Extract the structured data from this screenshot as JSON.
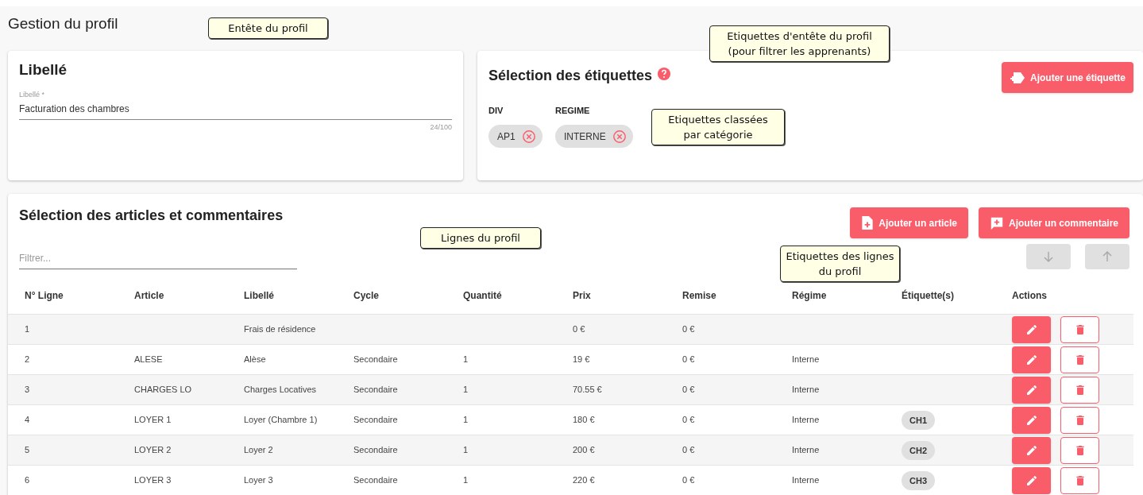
{
  "page_title": "Gestion du profil",
  "label_card": {
    "title": "Libellé",
    "field": {
      "label": "Libellé *",
      "value": "Facturation des chambres",
      "counter": "24/100"
    }
  },
  "tags_card": {
    "title": "Sélection des étiquettes",
    "add_button": "Ajouter une étiquette",
    "categories": [
      {
        "name": "DIV",
        "chips": [
          "AP1"
        ]
      },
      {
        "name": "REGIME",
        "chips": [
          "INTERNE"
        ]
      }
    ]
  },
  "lines_card": {
    "title": "Sélection des articles et commentaires",
    "buttons": [
      {
        "kind": "article",
        "label": "Ajouter un article"
      },
      {
        "kind": "comment",
        "label": "Ajouter un commentaire"
      }
    ],
    "filter": {
      "placeholder": "Filtrer..."
    },
    "move_buttons": [
      {
        "kind": "down",
        "disabled": true
      },
      {
        "kind": "up",
        "disabled": true
      }
    ],
    "columns": [
      "N° Ligne",
      "Article",
      "Libellé",
      "Cycle",
      "Quantité",
      "Prix",
      "Remise",
      "Régime",
      "Étiquette(s)",
      "Actions"
    ],
    "rows": [
      {
        "line": "1",
        "label": "Frais de résidence",
        "price": "0 €",
        "discount": "0 €"
      },
      {
        "line": "2",
        "article": "ALESE",
        "label": "Alèse",
        "cycle": "Secondaire",
        "quantity": "1",
        "price": "19 €",
        "discount": "0 €",
        "regime": "Interne"
      },
      {
        "line": "3",
        "article": "CHARGES LO",
        "label": "Charges Locatives",
        "cycle": "Secondaire",
        "quantity": "1",
        "price": "70.55 €",
        "discount": "0 €",
        "regime": "Interne"
      },
      {
        "line": "4",
        "article": "LOYER 1",
        "label": "Loyer (Chambre 1)",
        "cycle": "Secondaire",
        "quantity": "1",
        "price": "180 €",
        "discount": "0 €",
        "regime": "Interne",
        "tag": "CH1"
      },
      {
        "line": "5",
        "article": "LOYER 2",
        "label": "Loyer 2",
        "cycle": "Secondaire",
        "quantity": "1",
        "price": "200 €",
        "discount": "0 €",
        "regime": "Interne",
        "tag": "CH2"
      },
      {
        "line": "6",
        "article": "LOYER 3",
        "label": "Loyer 3",
        "cycle": "Secondaire",
        "quantity": "1",
        "price": "220 €",
        "discount": "0 €",
        "regime": "Interne",
        "tag": "CH3"
      }
    ]
  },
  "callouts": [
    {
      "lines": [
        "Entête du profil"
      ]
    },
    {
      "lines": [
        "Etiquettes d'entête du profil",
        "(pour filtrer les apprenants)"
      ]
    },
    {
      "lines": [
        "Etiquettes classées",
        "par catégorie"
      ]
    },
    {
      "lines": [
        "Lignes du profil"
      ]
    },
    {
      "lines": [
        "Etiquettes des lignes",
        "du profil"
      ]
    }
  ]
}
